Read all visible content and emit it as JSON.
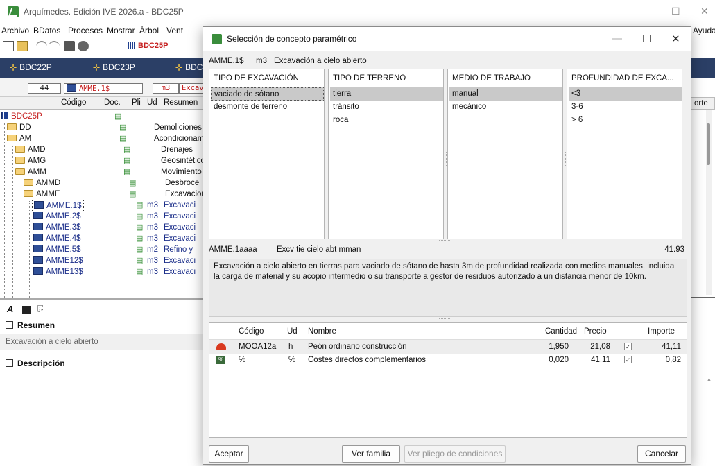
{
  "main_window": {
    "title": "Arquímedes. Edición IVE 2026.a - BDC25P",
    "menu": [
      "Archivo",
      "BDatos",
      "Procesos",
      "Mostrar",
      "Árbol",
      "Vent",
      "Ayuda"
    ],
    "toolbar_db": "BDC25P",
    "tabs": [
      "BDC22P",
      "BDC23P",
      "BDC"
    ],
    "tree_box": {
      "count": "44",
      "code": "AMME.1$",
      "unit": "m3",
      "summary": "Excav"
    },
    "tree_headers": {
      "codigo": "Código",
      "doc": "Doc.",
      "pli": "Pli",
      "ud": "Ud",
      "resumen": "Resumen",
      "importe": "orte"
    },
    "tree_rows": [
      {
        "code": "BDC25P",
        "unit": "",
        "summary": ""
      },
      {
        "code": "DD",
        "unit": "",
        "summary": "Demoliciones"
      },
      {
        "code": "AM",
        "unit": "",
        "summary": "Acondicionam"
      },
      {
        "code": "AMD",
        "unit": "",
        "summary": "Drenajes"
      },
      {
        "code": "AMG",
        "unit": "",
        "summary": "Geosintético"
      },
      {
        "code": "AMM",
        "unit": "",
        "summary": "Movimiento"
      },
      {
        "code": "AMMD",
        "unit": "",
        "summary": "Desbroce"
      },
      {
        "code": "AMME",
        "unit": "",
        "summary": "Excavacion"
      },
      {
        "code": "AMME.1$",
        "unit": "m3",
        "summary": "Excavaci"
      },
      {
        "code": "AMME.2$",
        "unit": "m3",
        "summary": "Excavaci"
      },
      {
        "code": "AMME.3$",
        "unit": "m3",
        "summary": "Excavaci"
      },
      {
        "code": "AMME.4$",
        "unit": "m3",
        "summary": "Excavaci"
      },
      {
        "code": "AMME.5$",
        "unit": "m2",
        "summary": "Refino y"
      },
      {
        "code": "AMME12$",
        "unit": "m3",
        "summary": "Excavaci"
      },
      {
        "code": "AMME13$",
        "unit": "m3",
        "summary": "Excavaci"
      }
    ],
    "props": {
      "resumen_label": "Resumen",
      "resumen_value": "Excavación a cielo abierto",
      "descripcion_label": "Descripción"
    }
  },
  "dialog": {
    "title": "Selección de concepto paramétrico",
    "header": {
      "code": "AMME.1$",
      "unit": "m3",
      "summary": "Excavación a cielo abierto"
    },
    "params": [
      {
        "title": "TIPO DE EXCAVACIÓN",
        "options": [
          "vaciado de sótano",
          "desmonte de terreno"
        ],
        "selected": 0
      },
      {
        "title": "TIPO DE TERRENO",
        "options": [
          "tierra",
          "tránsito",
          "roca"
        ],
        "selected": 0
      },
      {
        "title": "MEDIO DE TRABAJO",
        "options": [
          "manual",
          "mecánico"
        ],
        "selected": 0
      },
      {
        "title": "PROFUNDIDAD DE EXCA...",
        "options": [
          "<3",
          "3-6",
          "> 6"
        ],
        "selected": 0
      }
    ],
    "generated": {
      "code": "AMME.1aaaa",
      "short": "Excv tie cielo abt mman",
      "price": "41.93",
      "description": "Excavación a cielo abierto en tierras para vaciado de sótano de hasta 3m de profundidad realizada con medios manuales, incluida la carga de material y su acopio intermedio o su transporte a gestor de residuos autorizado a un distancia menor de 10km."
    },
    "decomp_headers": {
      "codigo": "Código",
      "ud": "Ud",
      "nombre": "Nombre",
      "cantidad": "Cantidad",
      "precio": "Precio",
      "importe": "Importe"
    },
    "decomp_rows": [
      {
        "icon": "helmet-icon",
        "codigo": "MOOA12a",
        "ud": "h",
        "nombre": "Peón ordinario construcción",
        "cantidad": "1,950",
        "precio": "21,08",
        "checked": true,
        "importe": "41,11"
      },
      {
        "icon": "percent-icon",
        "codigo": "%",
        "ud": "%",
        "nombre": "Costes directos complementarios",
        "cantidad": "0,020",
        "precio": "41,11",
        "checked": true,
        "importe": "0,82"
      }
    ],
    "buttons": {
      "accept": "Aceptar",
      "family": "Ver familia",
      "pliego": "Ver pliego de condiciones",
      "cancel": "Cancelar"
    }
  }
}
